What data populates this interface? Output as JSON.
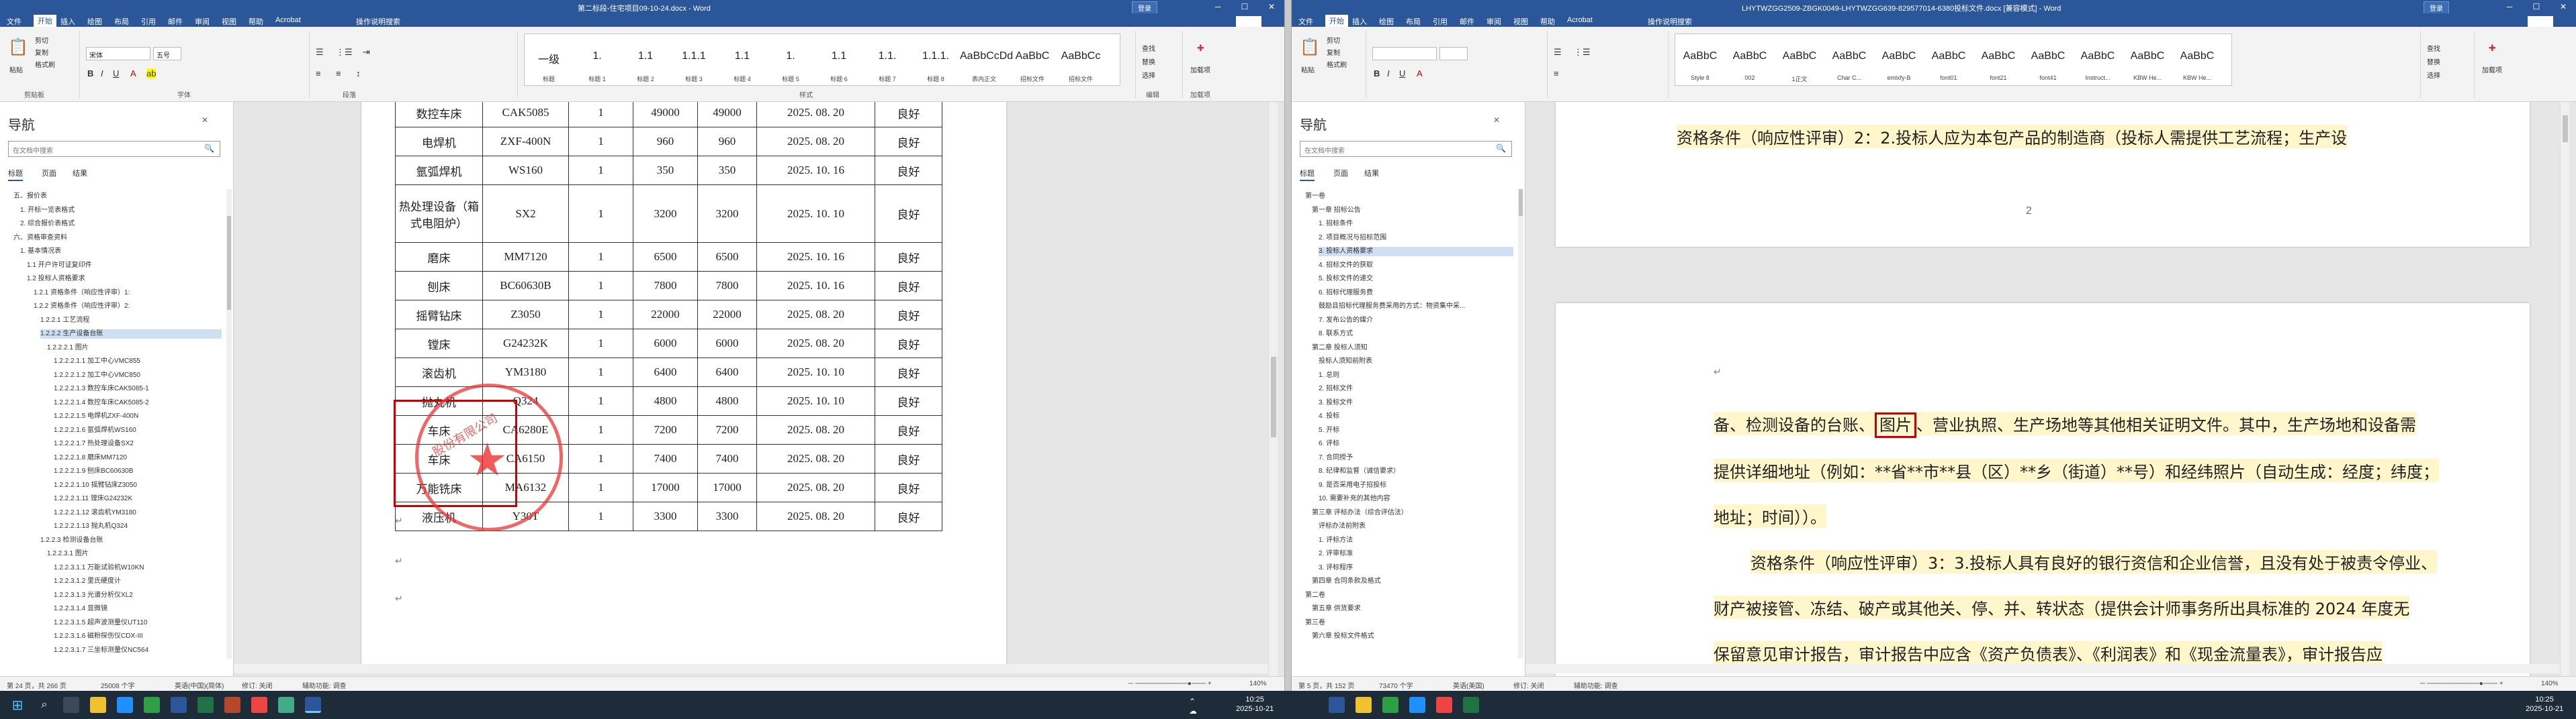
{
  "left_window": {
    "title": "第二标段-住宅项目09-10-24.docx - Word",
    "login": "登录",
    "menu": [
      "文件",
      "开始",
      "插入",
      "绘图",
      "布局",
      "引用",
      "邮件",
      "审阅",
      "视图",
      "帮助",
      "Acrobat",
      "操作说明搜索"
    ],
    "share": "共享",
    "ribbon": {
      "paste": "粘贴",
      "clipboard_items": [
        "剪切",
        "复制",
        "格式刷"
      ],
      "clipboard_label": "剪贴板",
      "font_name": "宋体",
      "font_size": "五号",
      "font_label": "字体",
      "para_label": "段落",
      "styles": [
        {
          "preview": "一级",
          "name": "标题"
        },
        {
          "preview": "1.",
          "name": "标题 1"
        },
        {
          "preview": "1.1",
          "name": "标题 2"
        },
        {
          "preview": "1.1.1",
          "name": "标题 3"
        },
        {
          "preview": "1.1",
          "name": "标题 4"
        },
        {
          "preview": "1.",
          "name": "标题 5"
        },
        {
          "preview": "1.1",
          "name": "标题 6"
        },
        {
          "preview": "1.1.",
          "name": "标题 7"
        },
        {
          "preview": "1.1.1.",
          "name": "标题 8"
        },
        {
          "preview": "AaBbCcDd",
          "name": "表内正文"
        },
        {
          "preview": "AaBbC",
          "name": "招标文件"
        },
        {
          "preview": "AaBbCc",
          "name": "招标文件"
        }
      ],
      "styles_label": "样式",
      "edit_items": [
        "查找",
        "替换",
        "选择"
      ],
      "edit_label": "编辑",
      "sign": "加载项",
      "sign2": "加载项"
    },
    "nav": {
      "title": "导航",
      "search_placeholder": "在文档中搜索",
      "tabs": [
        "标题",
        "页面",
        "结果"
      ],
      "items": [
        {
          "t": "五、报价表",
          "l": 1,
          "s": false
        },
        {
          "t": "1. 开标一览表格式",
          "l": 2,
          "s": false
        },
        {
          "t": "2. 综合报价表格式",
          "l": 2,
          "s": false
        },
        {
          "t": "六、资格审查资料",
          "l": 1,
          "s": false
        },
        {
          "t": "1. 基本情况表",
          "l": 2,
          "s": false
        },
        {
          "t": "1.1 开户许可证复印件",
          "l": 3,
          "s": false
        },
        {
          "t": "1.2 投标人资格要求",
          "l": 3,
          "s": false
        },
        {
          "t": "1.2.1 资格条件（响应性评审）1:",
          "l": 4,
          "s": false
        },
        {
          "t": "1.2.2 资格条件（响应性评审）2:",
          "l": 4,
          "s": false
        },
        {
          "t": "1.2.2.1 工艺流程",
          "l": 5,
          "s": false
        },
        {
          "t": "1.2.2.2 生产设备台账",
          "l": 5,
          "s": true
        },
        {
          "t": "1.2.2.2.1 图片",
          "l": 6,
          "s": false
        },
        {
          "t": "1.2.2.2.1.1 加工中心VMC855",
          "l": 7,
          "s": false
        },
        {
          "t": "1.2.2.2.1.2 加工中心VMC850",
          "l": 7,
          "s": false
        },
        {
          "t": "1.2.2.2.1.3 数控车床CAK5085-1",
          "l": 7,
          "s": false
        },
        {
          "t": "1.2.2.2.1.4 数控车床CAK5085-2",
          "l": 7,
          "s": false
        },
        {
          "t": "1.2.2.2.1.5 电焊机ZXF-400N",
          "l": 7,
          "s": false
        },
        {
          "t": "1.2.2.2.1.6 氩弧焊机WS160",
          "l": 7,
          "s": false
        },
        {
          "t": "1.2.2.2.1.7 热处理设备SX2",
          "l": 7,
          "s": false
        },
        {
          "t": "1.2.2.2.1.8 磨床MM7120",
          "l": 7,
          "s": false
        },
        {
          "t": "1.2.2.2.1.9 刨床BC60630B",
          "l": 7,
          "s": false
        },
        {
          "t": "1.2.2.2.1.10 摇臂钻床Z3050",
          "l": 7,
          "s": false
        },
        {
          "t": "1.2.2.2.1.11 镗床G24232K",
          "l": 7,
          "s": false
        },
        {
          "t": "1.2.2.2.1.12 滚齿机YM3180",
          "l": 7,
          "s": false
        },
        {
          "t": "1.2.2.2.1.13 抛丸机Q324",
          "l": 7,
          "s": false
        },
        {
          "t": "1.2.2.3 检测设备台账",
          "l": 5,
          "s": false
        },
        {
          "t": "1.2.2.3.1 图片",
          "l": 6,
          "s": false
        },
        {
          "t": "1.2.2.3.1.1 万能试验机W10KN",
          "l": 7,
          "s": false
        },
        {
          "t": "1.2.2.3.1.2 里氏硬度计",
          "l": 7,
          "s": false
        },
        {
          "t": "1.2.2.3.1.3 光谱分析仪XL2",
          "l": 7,
          "s": false
        },
        {
          "t": "1.2.2.3.1.4 显微镜",
          "l": 7,
          "s": false
        },
        {
          "t": "1.2.2.3.1.5 超声波测量仪UT110",
          "l": 7,
          "s": false
        },
        {
          "t": "1.2.2.3.1.6 磁粉探伤仪CDX-III",
          "l": 7,
          "s": false
        },
        {
          "t": "1.2.2.3.1.7 三坐标测量仪NC564",
          "l": 7,
          "s": false
        }
      ]
    },
    "table": [
      [
        "数控车床",
        "CAK5085",
        "1",
        "49000",
        "49000",
        "2025. 08. 20",
        "良好"
      ],
      [
        "电焊机",
        "ZXF-400N",
        "1",
        "960",
        "960",
        "2025. 08. 20",
        "良好"
      ],
      [
        "氩弧焊机",
        "WS160",
        "1",
        "350",
        "350",
        "2025. 10. 16",
        "良好"
      ],
      [
        "热处理设备（箱式电阻炉）",
        "SX2",
        "1",
        "3200",
        "3200",
        "2025. 10. 10",
        "良好"
      ],
      [
        "磨床",
        "MM7120",
        "1",
        "6500",
        "6500",
        "2025. 10. 16",
        "良好"
      ],
      [
        "刨床",
        "BC60630B",
        "1",
        "7800",
        "7800",
        "2025. 10. 16",
        "良好"
      ],
      [
        "摇臂钻床",
        "Z3050",
        "1",
        "22000",
        "22000",
        "2025. 08. 20",
        "良好"
      ],
      [
        "镗床",
        "G24232K",
        "1",
        "6000",
        "6000",
        "2025. 08. 20",
        "良好"
      ],
      [
        "滚齿机",
        "YM3180",
        "1",
        "6400",
        "6400",
        "2025. 10. 10",
        "良好"
      ],
      [
        "抛丸机",
        "Q324",
        "1",
        "4800",
        "4800",
        "2025. 10. 10",
        "良好"
      ],
      [
        "车床",
        "CA6280E",
        "1",
        "7200",
        "7200",
        "2025. 08. 20",
        "良好"
      ],
      [
        "车床",
        "CA6150",
        "1",
        "7400",
        "7400",
        "2025. 08. 20",
        "良好"
      ],
      [
        "万能铣床",
        "MA6132",
        "1",
        "17000",
        "17000",
        "2025. 08. 20",
        "良好"
      ],
      [
        "液压机",
        "Y30T",
        "1",
        "3300",
        "3300",
        "2025. 08. 20",
        "良好"
      ]
    ],
    "stamp_text": "股份有限公司",
    "status": [
      "第 24 页，共 266 页",
      "25008 个字",
      "英语(中国)(简体)",
      "修订: 关闭",
      "辅助功能: 调查",
      "140%"
    ]
  },
  "right_window": {
    "title": "LHYTWZGG2509-ZBGK0049-LHYTWZGG639-829577014-6380投标文件.docx [兼容模式] - Word",
    "login": "登录",
    "menu": [
      "文件",
      "开始",
      "插入",
      "绘图",
      "布局",
      "引用",
      "邮件",
      "审阅",
      "视图",
      "帮助",
      "Acrobat",
      "操作说明搜索"
    ],
    "share": "共享",
    "ribbon": {
      "paste": "粘贴",
      "clipboard_items": [
        "剪切",
        "复制",
        "格式刷"
      ],
      "styles": [
        {
          "preview": "AaBbC",
          "name": "Style 8"
        },
        {
          "preview": "AaBbC",
          "name": "002"
        },
        {
          "preview": "AaBbC",
          "name": "1正文"
        },
        {
          "preview": "AaBbC",
          "name": "Char C..."
        },
        {
          "preview": "AaBbC",
          "name": "emlxfy-B"
        },
        {
          "preview": "AaBbC",
          "name": "font01"
        },
        {
          "preview": "AaBbC",
          "name": "font21"
        },
        {
          "preview": "AaBbC",
          "name": "font41"
        },
        {
          "preview": "AaBbC",
          "name": "Instruct..."
        },
        {
          "preview": "AaBbC",
          "name": "KBW He..."
        },
        {
          "preview": "AaBbC",
          "name": "KBW He..."
        }
      ],
      "edit_items": [
        "查找",
        "替换",
        "选择"
      ],
      "sign": "加载项"
    },
    "nav": {
      "title": "导航",
      "search_placeholder": "在文档中搜索",
      "tabs": [
        "标题",
        "页面",
        "结果"
      ],
      "items": [
        {
          "t": "第一卷",
          "l": 1,
          "s": false
        },
        {
          "t": "第一章 招标公告",
          "l": 2,
          "s": false
        },
        {
          "t": "1. 招标条件",
          "l": 3,
          "s": false
        },
        {
          "t": "2. 项目概况与招标范围",
          "l": 3,
          "s": false
        },
        {
          "t": "3. 投标人资格要求",
          "l": 3,
          "s": true
        },
        {
          "t": "4. 招标文件的获取",
          "l": 3,
          "s": false
        },
        {
          "t": "5. 投标文件的递交",
          "l": 3,
          "s": false
        },
        {
          "t": "6. 招标代理服务费",
          "l": 3,
          "s": false
        },
        {
          "t": "鼓励且招标代理服务费采用的方式：物资集中采...",
          "l": 3,
          "s": false
        },
        {
          "t": "7. 发布公告的媒介",
          "l": 3,
          "s": false
        },
        {
          "t": "8. 联系方式",
          "l": 3,
          "s": false
        },
        {
          "t": "第二章 投标人须知",
          "l": 2,
          "s": false
        },
        {
          "t": "投标人须知前附表",
          "l": 3,
          "s": false
        },
        {
          "t": "1. 总则",
          "l": 3,
          "s": false
        },
        {
          "t": "2. 招标文件",
          "l": 3,
          "s": false
        },
        {
          "t": "3. 投标文件",
          "l": 3,
          "s": false
        },
        {
          "t": "4. 投标",
          "l": 3,
          "s": false
        },
        {
          "t": "5. 开标",
          "l": 3,
          "s": false
        },
        {
          "t": "6. 评标",
          "l": 3,
          "s": false
        },
        {
          "t": "7. 合同授予",
          "l": 3,
          "s": false
        },
        {
          "t": "8. 纪律和监督（诚信要求）",
          "l": 3,
          "s": false
        },
        {
          "t": "9. 是否采用电子招投标",
          "l": 3,
          "s": false
        },
        {
          "t": "10. 需要补充的其他内容",
          "l": 3,
          "s": false
        },
        {
          "t": "第三章 评标办法（综合评估法）",
          "l": 2,
          "s": false
        },
        {
          "t": "评标办法前附表",
          "l": 3,
          "s": false
        },
        {
          "t": "1. 评标方法",
          "l": 3,
          "s": false
        },
        {
          "t": "2. 评审标准",
          "l": 3,
          "s": false
        },
        {
          "t": "3. 评标程序",
          "l": 3,
          "s": false
        },
        {
          "t": "第四章 合同条款及格式",
          "l": 2,
          "s": false
        },
        {
          "t": "第二卷",
          "l": 1,
          "s": false
        },
        {
          "t": "第五章 供货要求",
          "l": 2,
          "s": false
        },
        {
          "t": "第三卷",
          "l": 1,
          "s": false
        },
        {
          "t": "第六章 投标文件格式",
          "l": 2,
          "s": false
        }
      ]
    },
    "doc": {
      "top_para": "资格条件（响应性评审）2：2.投标人应为本包产品的制造商（投标人需提供工艺流程；生产设",
      "page_num": "2",
      "line1_pre": "备、检测设备的台账、",
      "line1_box": "图片",
      "line1_post": "、营业执照、生产场地等其他相关证明文件。其中，生产场地和设备需",
      "line2": "提供详细地址（例如：**省**市**县（区）**乡（街道）**号）和经纬照片（自动生成：经度；纬度；",
      "line3": "地址；时间））。",
      "line4": "资格条件（响应性评审）3：3.投标人具有良好的银行资信和企业信誉，且没有处于被责令停业、",
      "line5": "财产被接管、冻结、破产或其他关、停、并、转状态（提供会计师事务所出具标准的 2024 年度无",
      "line6": "保留意见审计报告，审计报告中应含《资产负债表》、《利润表》和《现金流量表》，审计报告应"
    },
    "status": [
      "第 5 页，共 152 页",
      "73470 个字",
      "英语(美国)",
      "修订: 关闭",
      "辅助功能: 调查",
      "140%"
    ]
  },
  "taskbar": {
    "time": "10:25",
    "date": "2025-10-21"
  }
}
